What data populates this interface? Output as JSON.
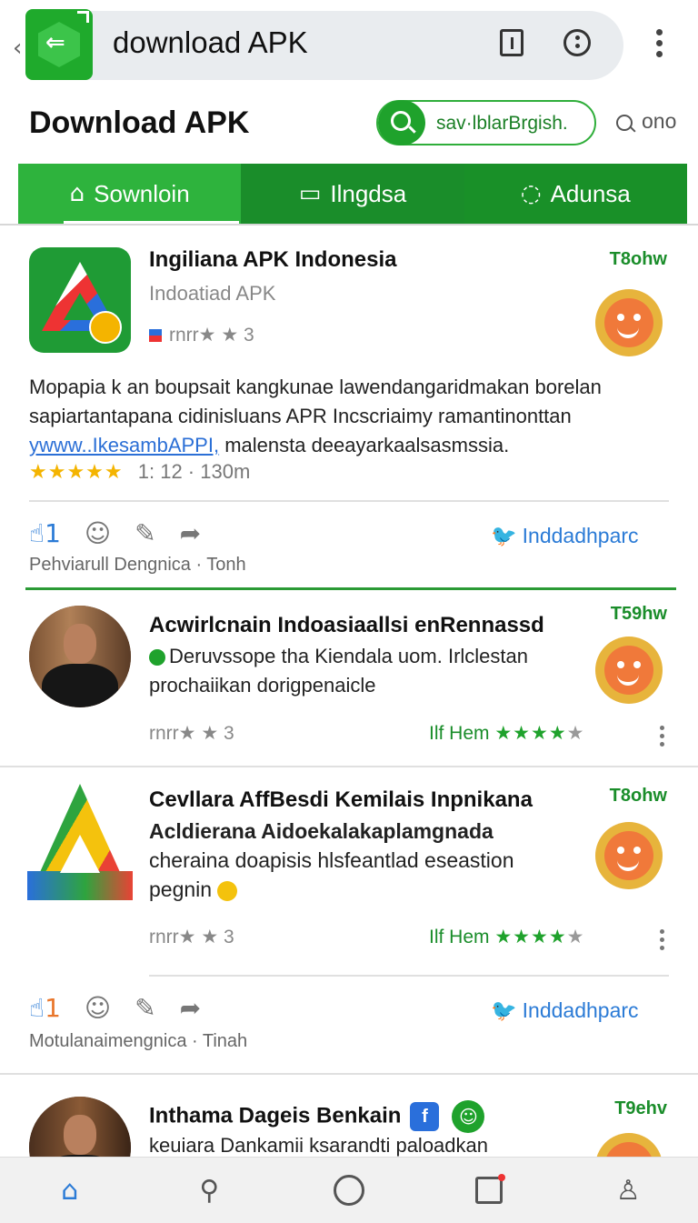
{
  "browser": {
    "url_text": "download APK",
    "back_icon": "chevron-left-icon",
    "reader_icon": "reader-mode-icon",
    "info_icon": "info-icon",
    "menu_icon": "kebab-menu-icon"
  },
  "header": {
    "title": "Download APK",
    "search_value": "sav·lblarBrgish.",
    "side_label": "ono"
  },
  "tabs": [
    {
      "label": "Sownloin",
      "icon": "home-icon"
    },
    {
      "label": "Ilngdsa",
      "icon": "chat-icon"
    },
    {
      "label": "Adunsa",
      "icon": "message-icon"
    }
  ],
  "cards": [
    {
      "title": "Ingiliana APK Indonesia",
      "subtitle": "Indoatiad APK",
      "rating_text": "rnrr★ ★ 3",
      "time": "T8ohw",
      "body": [
        "Mopapia  k  an  boupsait  kangkunae  lawendangaridmakan  borelan",
        "sapiartantapana  cidinisluans  APR  Incscriaimy  ramantinonttan"
      ],
      "link": "ywww..IkesambAPPI,",
      "body_tail": " malensta  deeayarkaalsasmssia.",
      "stars": "★★★★★",
      "stats": "1: 12 · 130m",
      "like_count": "1",
      "share_label": "Inddadhparc",
      "meta": "Pehviarull Dengnica  ·  Tonh"
    },
    {
      "title": "Acwirlcnain Indoasiaallsi enRennassd",
      "line2": "Deruvssope tha Kiendala uom. Irlclestan",
      "line3": "prochaiikan dorigpenaicle",
      "rating_text": "rnrr★ ★ 3",
      "time": "T59hw",
      "right_label": "Ilf Hem",
      "right_stars_gold": "★★★★",
      "right_stars_gray": "★"
    },
    {
      "title": "Cevllara AffBesdi Kemilais Inpnikana",
      "line2": "Acldierana Aidoekalakaplamgnada",
      "line3": "cheraina doapisis hlsfeantlad eseastion",
      "line4": "pegnin",
      "rating_text": "rnrr★ ★ 3",
      "time": "T8ohw",
      "right_label": "Ilf Hem",
      "right_stars_gold": "★★★★",
      "right_stars_gray": "★",
      "like_count": "1",
      "share_label": "Inddadhparc",
      "meta": "Motulanaimengnica  ·  Tinah"
    },
    {
      "title": "Inthama Dageis Benkain",
      "line2": "keuiara  Dankamii ksarandti paloadkan",
      "time": "T9ehv"
    }
  ],
  "bottom_nav": [
    {
      "name": "home",
      "icon": "home-icon"
    },
    {
      "name": "search",
      "icon": "search-icon"
    },
    {
      "name": "circle",
      "icon": "circle-icon"
    },
    {
      "name": "tabs",
      "icon": "tabs-icon"
    },
    {
      "name": "profile",
      "icon": "profile-icon"
    }
  ],
  "colors": {
    "brand_green": "#1fa22c",
    "link_blue": "#2b7bd6",
    "star_gold": "#f4b400"
  }
}
